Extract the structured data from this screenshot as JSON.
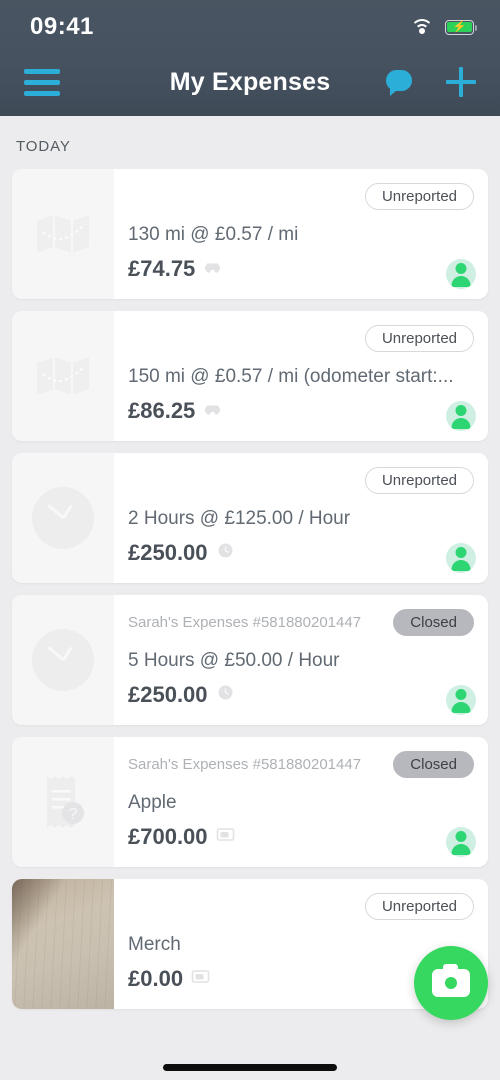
{
  "status_bar": {
    "time": "09:41",
    "wifi_icon": "wifi-icon",
    "battery_icon": "battery-charging-icon"
  },
  "header": {
    "title": "My Expenses",
    "menu_icon": "hamburger-menu-icon",
    "chat_icon": "chat-bubble-icon",
    "add_icon": "plus-icon",
    "background_color": "#46525F",
    "accent_color": "#2BAFD9"
  },
  "section": {
    "label": "TODAY"
  },
  "theme": {
    "green": "#2ED573",
    "fab_green": "#36D860",
    "card_bg": "#FFFFFF",
    "page_bg": "#ECECEE"
  },
  "expenses": [
    {
      "thumb_icon": "map-icon",
      "report": "",
      "status": "Unreported",
      "status_type": "unreported",
      "description": "130 mi @ £0.57 / mi",
      "amount": "£74.75",
      "type_icon": "car-icon",
      "avatar": "user-avatar"
    },
    {
      "thumb_icon": "map-icon",
      "report": "",
      "status": "Unreported",
      "status_type": "unreported",
      "description": "150 mi @ £0.57 / mi (odometer start:...",
      "amount": "£86.25",
      "type_icon": "car-icon",
      "avatar": "user-avatar"
    },
    {
      "thumb_icon": "clock-icon",
      "report": "",
      "status": "Unreported",
      "status_type": "unreported",
      "description": "2 Hours @ £125.00 / Hour",
      "amount": "£250.00",
      "type_icon": "clock-icon",
      "avatar": "user-avatar"
    },
    {
      "thumb_icon": "clock-icon",
      "report": "Sarah's Expenses #581880201447",
      "status": "Closed",
      "status_type": "closed",
      "description": "5 Hours @ £50.00 / Hour",
      "amount": "£250.00",
      "type_icon": "clock-icon",
      "avatar": "user-avatar"
    },
    {
      "thumb_icon": "receipt-question-icon",
      "report": "Sarah's Expenses #581880201447",
      "status": "Closed",
      "status_type": "closed",
      "description": "Apple",
      "amount": "£700.00",
      "type_icon": "receipt-icon",
      "avatar": "user-avatar"
    },
    {
      "thumb_icon": "receipt-photo",
      "report": "",
      "status": "Unreported",
      "status_type": "unreported",
      "description": "Merch",
      "amount": "£0.00",
      "type_icon": "receipt-icon",
      "avatar": "user-avatar"
    }
  ],
  "fab": {
    "icon": "camera-icon",
    "label": "Scan receipt"
  }
}
